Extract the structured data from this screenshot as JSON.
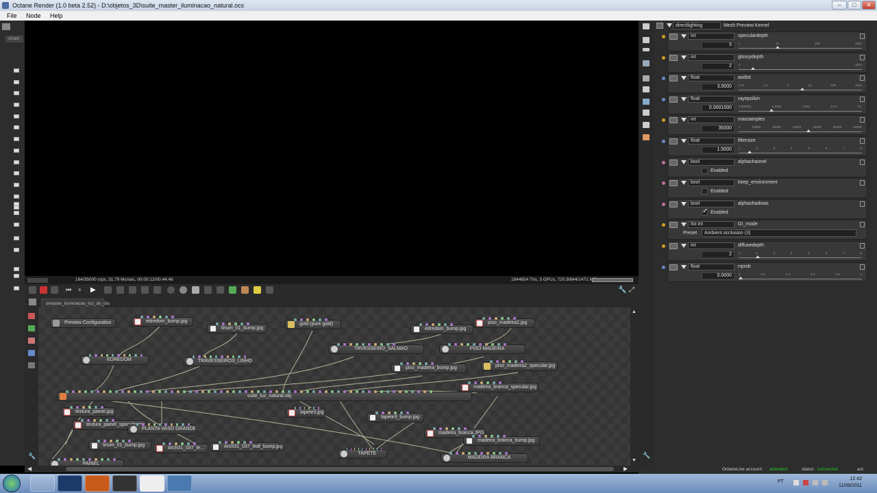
{
  "window": {
    "title": "Octane Render (1.0 beta 2.52) - D:\\objetos_3D\\suite_master_iluminacao_natural.ocs",
    "min": "–",
    "max": "□",
    "close": "✕"
  },
  "menu": [
    "File",
    "Node",
    "Help"
  ],
  "left_panel": {
    "tab": "smast"
  },
  "viewport": {
    "status_left": "164/35000 s/px, 31.79 Ms/sec, 00:00:12/00:44:46",
    "status_right": "1944654 Tris, 3 GPUs, 720.9/844/1471 MB"
  },
  "node_graph": {
    "tab": "smaster_iluminacao_luz_do_dia",
    "nodes": [
      {
        "label": "Preview Configuration",
        "kind": "cfg"
      },
      {
        "label": "edredom_bump.jpg",
        "kind": "tex"
      },
      {
        "label": "linum_01_bump.jpg",
        "kind": "bump"
      },
      {
        "label": "gold (pure gold)",
        "kind": "gold"
      },
      {
        "label": "edredom_bump.jpg",
        "kind": "bump"
      },
      {
        "label": "piso_madeira2.jpg",
        "kind": "tex"
      },
      {
        "label": "EDREDOM",
        "kind": "mat"
      },
      {
        "label": "TRAVESSEIROS_LINHO",
        "kind": "mat"
      },
      {
        "label": "TRVESSEIRO_SALMAO",
        "kind": "mat"
      },
      {
        "label": "PISO MADEIRA",
        "kind": "mat"
      },
      {
        "label": "piso_madeira_bump.jpg",
        "kind": "bump"
      },
      {
        "label": "piso_madeira2_specular.jpg",
        "kind": "gold"
      },
      {
        "label": "suite_luz_natural.obj",
        "kind": "mesh"
      },
      {
        "label": "madeira_branca_specular.jpg",
        "kind": "tex"
      },
      {
        "label": "textura_painel.jpg",
        "kind": "tex"
      },
      {
        "label": "tapete3.jpg",
        "kind": "tex"
      },
      {
        "label": "tapete3_bump.jpg",
        "kind": "bump"
      },
      {
        "label": "textura_painel_specular.jpg",
        "kind": "tex"
      },
      {
        "label": "PLANTA VASO GRANDE",
        "kind": "mat"
      },
      {
        "label": "madeira_branca.JPG",
        "kind": "tex"
      },
      {
        "label": "madeira_branca_bump.jpg",
        "kind": "bump"
      },
      {
        "label": "linum_01_bump.jpg",
        "kind": "bump"
      },
      {
        "label": "Arch31_037_le...",
        "kind": "tex"
      },
      {
        "label": "Arch31_037_leaf_bump.jpg",
        "kind": "bump"
      },
      {
        "label": "TAPETE",
        "kind": "mat"
      },
      {
        "label": "MADEIRA BRANCA",
        "kind": "mat"
      },
      {
        "label": "PAINEL",
        "kind": "mat"
      }
    ]
  },
  "kernel": {
    "name": "directlighting",
    "title": "Mesh Preview Kernel"
  },
  "params": [
    {
      "type": "int",
      "name": "speculardepth",
      "value": "5",
      "ticks": [
        "1",
        "10",
        "100",
        "1024"
      ],
      "pos": 0.3,
      "dot": "#d0a020",
      "kind": "slider"
    },
    {
      "type": "int",
      "name": "glossydepth",
      "value": "2",
      "ticks": [
        "1",
        "",
        "",
        "1024"
      ],
      "pos": 0.1,
      "dot": "#d0a020",
      "kind": "slider"
    },
    {
      "type": "float",
      "name": "aodist",
      "value": "3.0000",
      "ticks": [
        "0.01",
        "0.1",
        "1",
        "10",
        "100",
        "1024"
      ],
      "pos": 0.5,
      "dot": "#6a8ad0",
      "kind": "slider"
    },
    {
      "type": "float",
      "name": "rayepsilon",
      "value": "0.0001000",
      "ticks": [
        "0.000001",
        "0.0001",
        "0.001",
        "0.01",
        "0.1"
      ],
      "pos": 0.25,
      "dot": "#6a8ad0",
      "kind": "slider"
    },
    {
      "type": "int",
      "name": "maxsamples",
      "value": "35000",
      "ticks": [
        "1",
        "10000",
        "20000",
        "30000",
        "40000",
        "50000",
        "64000"
      ],
      "pos": 0.55,
      "dot": "#d0a020",
      "kind": "slider"
    },
    {
      "type": "float",
      "name": "filtersize",
      "value": "1.5000",
      "ticks": [
        "1",
        "2",
        "3",
        "4",
        "5",
        "6",
        "7",
        "8"
      ],
      "pos": 0.07,
      "dot": "#6a8ad0",
      "kind": "slider"
    },
    {
      "type": "bool",
      "name": "alphachannel",
      "value": "Enabled",
      "checked": false,
      "dot": "#c070a0",
      "kind": "bool"
    },
    {
      "type": "bool",
      "name": "keep_environment",
      "value": "Enabled",
      "checked": false,
      "dot": "#c070a0",
      "kind": "bool"
    },
    {
      "type": "bool",
      "name": "alphashadows",
      "value": "Enabled",
      "checked": true,
      "dot": "#c070a0",
      "kind": "bool"
    },
    {
      "type": "list int",
      "name": "GI_mode",
      "preset_label": "Preset",
      "value": "Ambient occlusion (3)",
      "dot": "#d0a020",
      "kind": "list"
    },
    {
      "type": "int",
      "name": "diffusedepth",
      "value": "2",
      "ticks": [
        "1",
        "2",
        "3",
        "4",
        "5",
        "6",
        "7",
        "8"
      ],
      "pos": 0.14,
      "dot": "#d0a020",
      "kind": "slider"
    },
    {
      "type": "float",
      "name": "rrprob",
      "value": "0.0000",
      "ticks": [
        "0",
        "0.2",
        "0.4",
        "0.6",
        "0.8",
        "1"
      ],
      "pos": 0.0,
      "dot": "#6a8ad0",
      "kind": "slider"
    }
  ],
  "status": {
    "account_label": "OctaneLive account:",
    "account_value": "activated",
    "status_label": "status:",
    "status_value": "connected",
    "act_label": "act:"
  },
  "taskbar": {
    "lang": "PT",
    "time": "12:42",
    "date": "11/09/2011"
  },
  "colors": {
    "accent_green": "#22cc22",
    "bg": "#2d2d2d"
  }
}
